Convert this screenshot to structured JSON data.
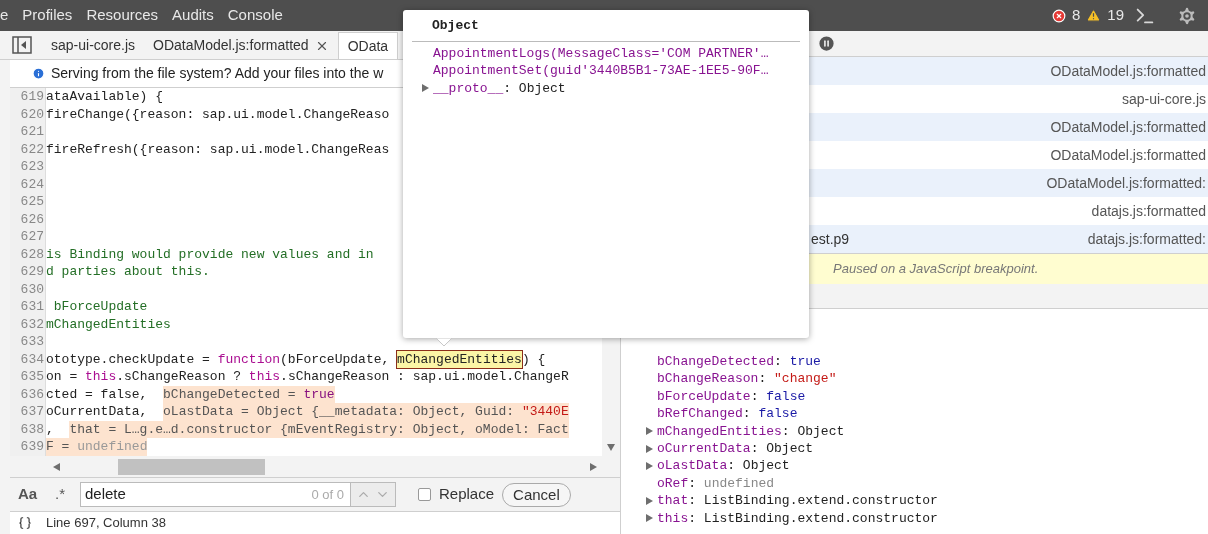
{
  "top_bar": {
    "panels": [
      {
        "label": "e",
        "selected": false
      },
      {
        "label": "Profiles",
        "selected": false
      },
      {
        "label": "Resources",
        "selected": false
      },
      {
        "label": "Audits",
        "selected": false
      },
      {
        "label": "Console",
        "selected": false
      }
    ],
    "error_count": "8",
    "warning_count": "19"
  },
  "editor_tabs": [
    {
      "label": "sap-ui-core.js",
      "selected": false,
      "closable": false
    },
    {
      "label": "ODataModel.js:formatted",
      "selected": false,
      "closable": true
    },
    {
      "label": "OData",
      "selected": true,
      "closable": false
    }
  ],
  "info_bar": {
    "text": "Serving from the file system? Add your files into the w"
  },
  "code_lines": [
    {
      "number": "619",
      "segments": [
        {
          "kind": "plain",
          "text": "ataAvailable) {"
        }
      ]
    },
    {
      "number": "620",
      "segments": [
        {
          "kind": "plain",
          "text": "fireChange({reason: sap.ui.model.ChangeReaso"
        }
      ]
    },
    {
      "number": "621"
    },
    {
      "number": "622",
      "segments": [
        {
          "kind": "plain",
          "text": "fireRefresh({reason: sap.ui.model.ChangeReas"
        }
      ]
    },
    {
      "number": "623"
    },
    {
      "number": "624"
    },
    {
      "number": "625"
    },
    {
      "number": "626"
    },
    {
      "number": "627"
    },
    {
      "number": "628",
      "segments": [
        {
          "kind": "comment",
          "text": "is Binding would provide new values and in"
        }
      ]
    },
    {
      "number": "629",
      "segments": [
        {
          "kind": "comment",
          "text": "d parties about this."
        }
      ]
    },
    {
      "number": "630"
    },
    {
      "number": "631",
      "segments": [
        {
          "kind": "comment",
          "text": " bForceUpdate"
        }
      ]
    },
    {
      "number": "632",
      "segments": [
        {
          "kind": "comment",
          "text": "mChangedEntities"
        }
      ]
    },
    {
      "number": "633"
    },
    {
      "number": "634",
      "segments": [
        {
          "kind": "plain",
          "text": "ototype.checkUpdate = "
        },
        {
          "kind": "keyword",
          "text": "function"
        },
        {
          "kind": "plain",
          "text": "(bForceUpdate, "
        },
        {
          "kind": "highlight",
          "text": "mChangedEntities"
        },
        {
          "kind": "plain",
          "text": ") {"
        }
      ]
    },
    {
      "number": "635",
      "segments": [
        {
          "kind": "plain",
          "text": "on = "
        },
        {
          "kind": "keyword",
          "text": "this"
        },
        {
          "kind": "plain",
          "text": ".sChangeReason ? "
        },
        {
          "kind": "keyword",
          "text": "this"
        },
        {
          "kind": "plain",
          "text": ".sChangeReason : sap.ui.model.ChangeR"
        }
      ]
    },
    {
      "number": "636",
      "segments": [
        {
          "kind": "plain",
          "text": "cted = false,  "
        },
        {
          "kind": "value",
          "text": "bChangeDetected = "
        },
        {
          "kind": "value_keyword",
          "text": "true"
        }
      ]
    },
    {
      "number": "637",
      "segments": [
        {
          "kind": "plain",
          "text": "oCurrentData,  "
        },
        {
          "kind": "value",
          "text": "oLastData = Object {__metadata: Object, Guid: "
        },
        {
          "kind": "value_string",
          "text": "\"3440E"
        }
      ]
    },
    {
      "number": "638",
      "segments": [
        {
          "kind": "plain",
          "text": ",  "
        },
        {
          "kind": "value",
          "text": "that = L…g.e…d.constructor {mEventRegistry: Object, oModel: Fact"
        }
      ]
    },
    {
      "number": "639",
      "segments": [
        {
          "kind": "value",
          "text": "F = "
        },
        {
          "kind": "value_undefined",
          "text": "undefined"
        }
      ]
    }
  ],
  "search_bar": {
    "case_toggle": "Aa",
    "regex_toggle": ".*",
    "value": "delete",
    "match_count": "0 of 0",
    "replace": {
      "label": "Replace",
      "checked": false
    },
    "cancel": "Cancel"
  },
  "status_bar": {
    "position": "Line 697, Column 38"
  },
  "call_stack": [
    {
      "location": "ODataModel.js:formatted"
    },
    {
      "location": "sap-ui-core.js"
    },
    {
      "location": "ODataModel.js:formatted"
    },
    {
      "location": "ODataModel.js:formatted"
    },
    {
      "location": "ODataModel.js:formatted:"
    },
    {
      "location": "datajs.js:formatted"
    },
    {
      "function": "est.p9",
      "location": "datajs.js:formatted:"
    }
  ],
  "paused_message": "Paused on a JavaScript breakpoint.",
  "scope": [
    {
      "name": "bChangeDetected",
      "separator": ":",
      "value": "true",
      "kind": "boolean",
      "expandable": false
    },
    {
      "name": "bChangeReason",
      "separator": ":",
      "value": "\"change\"",
      "kind": "string",
      "expandable": false
    },
    {
      "name": "bForceUpdate",
      "separator": ":",
      "value": "false",
      "kind": "boolean",
      "expandable": false
    },
    {
      "name": "bRefChanged",
      "separator": ":",
      "value": "false",
      "kind": "boolean",
      "expandable": false
    },
    {
      "name": "mChangedEntities",
      "separator": ":",
      "value": "Object",
      "kind": "object",
      "expandable": true
    },
    {
      "name": "oCurrentData",
      "separator": ":",
      "value": "Object",
      "kind": "object",
      "expandable": true
    },
    {
      "name": "oLastData",
      "separator": ":",
      "value": "Object",
      "kind": "object",
      "expandable": true
    },
    {
      "name": "oRef",
      "separator": ":",
      "value": "undefined",
      "kind": "undefined",
      "expandable": false
    },
    {
      "name": "that",
      "separator": ":",
      "value": "ListBinding.extend.constructor",
      "kind": "object",
      "expandable": true
    },
    {
      "name": "this",
      "separator": ":",
      "value": "ListBinding.extend.constructor",
      "kind": "object",
      "expandable": true
    }
  ],
  "popover": {
    "title": "Object",
    "properties": [
      {
        "name": "AppointmentLogs(MessageClass='COM PARTNER'…",
        "expandable": false
      },
      {
        "name": "AppointmentSet(guid'3440B5B1-73AE-1EE5-90F…",
        "expandable": false
      },
      {
        "name": "__proto__",
        "separator": ":",
        "value": "Object",
        "expandable": true
      }
    ]
  }
}
